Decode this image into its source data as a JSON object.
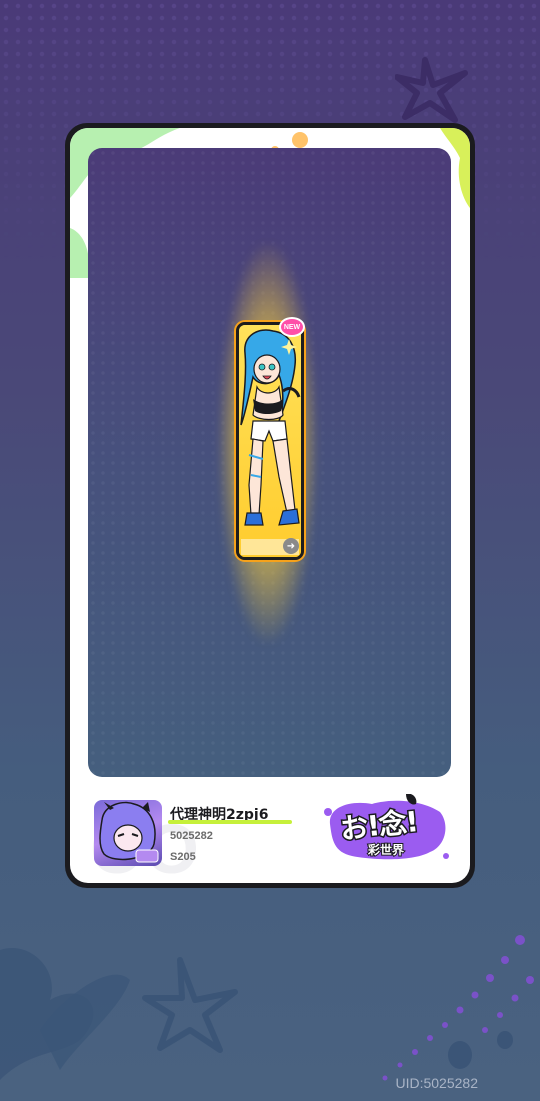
{
  "player": {
    "name": "代理神明2zpj6",
    "id": "5025282",
    "season": "S205"
  },
  "card": {
    "badge": "NEW"
  },
  "logo": {
    "main": "お!念!",
    "sub": "彩世界"
  },
  "uid_label": "UID:5025282",
  "icons": {
    "new": "new-badge-icon",
    "swap": "swap-arrow-icon",
    "star": "star-icon"
  },
  "colors": {
    "accent_yellow": "#ffd84a",
    "accent_lime": "#c6f03a",
    "accent_pink": "#ff4fa8",
    "accent_purple": "#9b5cf0"
  }
}
